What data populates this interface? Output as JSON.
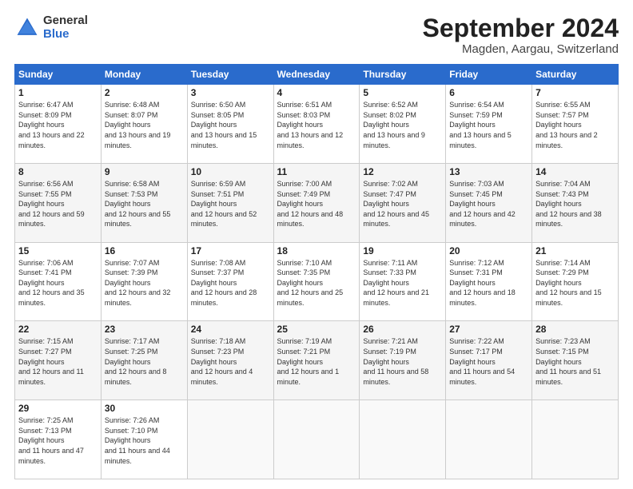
{
  "logo": {
    "general": "General",
    "blue": "Blue"
  },
  "title": {
    "month": "September 2024",
    "location": "Magden, Aargau, Switzerland"
  },
  "weekdays": [
    "Sunday",
    "Monday",
    "Tuesday",
    "Wednesday",
    "Thursday",
    "Friday",
    "Saturday"
  ],
  "weeks": [
    [
      {
        "day": "1",
        "sunrise": "6:47 AM",
        "sunset": "8:09 PM",
        "daylight": "13 hours and 22 minutes."
      },
      {
        "day": "2",
        "sunrise": "6:48 AM",
        "sunset": "8:07 PM",
        "daylight": "13 hours and 19 minutes."
      },
      {
        "day": "3",
        "sunrise": "6:50 AM",
        "sunset": "8:05 PM",
        "daylight": "13 hours and 15 minutes."
      },
      {
        "day": "4",
        "sunrise": "6:51 AM",
        "sunset": "8:03 PM",
        "daylight": "13 hours and 12 minutes."
      },
      {
        "day": "5",
        "sunrise": "6:52 AM",
        "sunset": "8:02 PM",
        "daylight": "13 hours and 9 minutes."
      },
      {
        "day": "6",
        "sunrise": "6:54 AM",
        "sunset": "7:59 PM",
        "daylight": "13 hours and 5 minutes."
      },
      {
        "day": "7",
        "sunrise": "6:55 AM",
        "sunset": "7:57 PM",
        "daylight": "13 hours and 2 minutes."
      }
    ],
    [
      {
        "day": "8",
        "sunrise": "6:56 AM",
        "sunset": "7:55 PM",
        "daylight": "12 hours and 59 minutes."
      },
      {
        "day": "9",
        "sunrise": "6:58 AM",
        "sunset": "7:53 PM",
        "daylight": "12 hours and 55 minutes."
      },
      {
        "day": "10",
        "sunrise": "6:59 AM",
        "sunset": "7:51 PM",
        "daylight": "12 hours and 52 minutes."
      },
      {
        "day": "11",
        "sunrise": "7:00 AM",
        "sunset": "7:49 PM",
        "daylight": "12 hours and 48 minutes."
      },
      {
        "day": "12",
        "sunrise": "7:02 AM",
        "sunset": "7:47 PM",
        "daylight": "12 hours and 45 minutes."
      },
      {
        "day": "13",
        "sunrise": "7:03 AM",
        "sunset": "7:45 PM",
        "daylight": "12 hours and 42 minutes."
      },
      {
        "day": "14",
        "sunrise": "7:04 AM",
        "sunset": "7:43 PM",
        "daylight": "12 hours and 38 minutes."
      }
    ],
    [
      {
        "day": "15",
        "sunrise": "7:06 AM",
        "sunset": "7:41 PM",
        "daylight": "12 hours and 35 minutes."
      },
      {
        "day": "16",
        "sunrise": "7:07 AM",
        "sunset": "7:39 PM",
        "daylight": "12 hours and 32 minutes."
      },
      {
        "day": "17",
        "sunrise": "7:08 AM",
        "sunset": "7:37 PM",
        "daylight": "12 hours and 28 minutes."
      },
      {
        "day": "18",
        "sunrise": "7:10 AM",
        "sunset": "7:35 PM",
        "daylight": "12 hours and 25 minutes."
      },
      {
        "day": "19",
        "sunrise": "7:11 AM",
        "sunset": "7:33 PM",
        "daylight": "12 hours and 21 minutes."
      },
      {
        "day": "20",
        "sunrise": "7:12 AM",
        "sunset": "7:31 PM",
        "daylight": "12 hours and 18 minutes."
      },
      {
        "day": "21",
        "sunrise": "7:14 AM",
        "sunset": "7:29 PM",
        "daylight": "12 hours and 15 minutes."
      }
    ],
    [
      {
        "day": "22",
        "sunrise": "7:15 AM",
        "sunset": "7:27 PM",
        "daylight": "12 hours and 11 minutes."
      },
      {
        "day": "23",
        "sunrise": "7:17 AM",
        "sunset": "7:25 PM",
        "daylight": "12 hours and 8 minutes."
      },
      {
        "day": "24",
        "sunrise": "7:18 AM",
        "sunset": "7:23 PM",
        "daylight": "12 hours and 4 minutes."
      },
      {
        "day": "25",
        "sunrise": "7:19 AM",
        "sunset": "7:21 PM",
        "daylight": "12 hours and 1 minute."
      },
      {
        "day": "26",
        "sunrise": "7:21 AM",
        "sunset": "7:19 PM",
        "daylight": "11 hours and 58 minutes."
      },
      {
        "day": "27",
        "sunrise": "7:22 AM",
        "sunset": "7:17 PM",
        "daylight": "11 hours and 54 minutes."
      },
      {
        "day": "28",
        "sunrise": "7:23 AM",
        "sunset": "7:15 PM",
        "daylight": "11 hours and 51 minutes."
      }
    ],
    [
      {
        "day": "29",
        "sunrise": "7:25 AM",
        "sunset": "7:13 PM",
        "daylight": "11 hours and 47 minutes."
      },
      {
        "day": "30",
        "sunrise": "7:26 AM",
        "sunset": "7:10 PM",
        "daylight": "11 hours and 44 minutes."
      },
      {
        "day": "",
        "sunrise": "",
        "sunset": "",
        "daylight": ""
      },
      {
        "day": "",
        "sunrise": "",
        "sunset": "",
        "daylight": ""
      },
      {
        "day": "",
        "sunrise": "",
        "sunset": "",
        "daylight": ""
      },
      {
        "day": "",
        "sunrise": "",
        "sunset": "",
        "daylight": ""
      },
      {
        "day": "",
        "sunrise": "",
        "sunset": "",
        "daylight": ""
      }
    ]
  ]
}
